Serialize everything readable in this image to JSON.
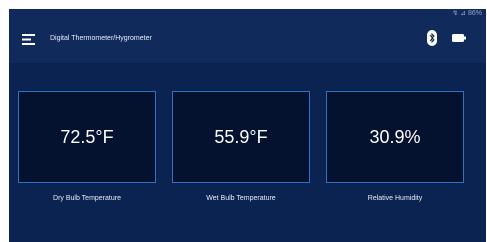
{
  "status_bar": {
    "text": "↯ ⊿ 86%"
  },
  "app_bar": {
    "title": "Digital Thermometer/Hygrometer",
    "menu_icon": "menu-icon",
    "bluetooth_icon": "bluetooth-icon",
    "battery_icon": "battery-icon"
  },
  "readings": [
    {
      "value": "72.5°F",
      "label": "Dry Bulb Temperature"
    },
    {
      "value": "55.9°F",
      "label": "Wet Bulb Temperature"
    },
    {
      "value": "30.9%",
      "label": "Relative Humidity"
    }
  ],
  "colors": {
    "background": "#0b2350",
    "app_bar": "#102a5c",
    "card_fill": "#04112f",
    "card_border": "#2f6fc4",
    "text": "#ffffff"
  }
}
